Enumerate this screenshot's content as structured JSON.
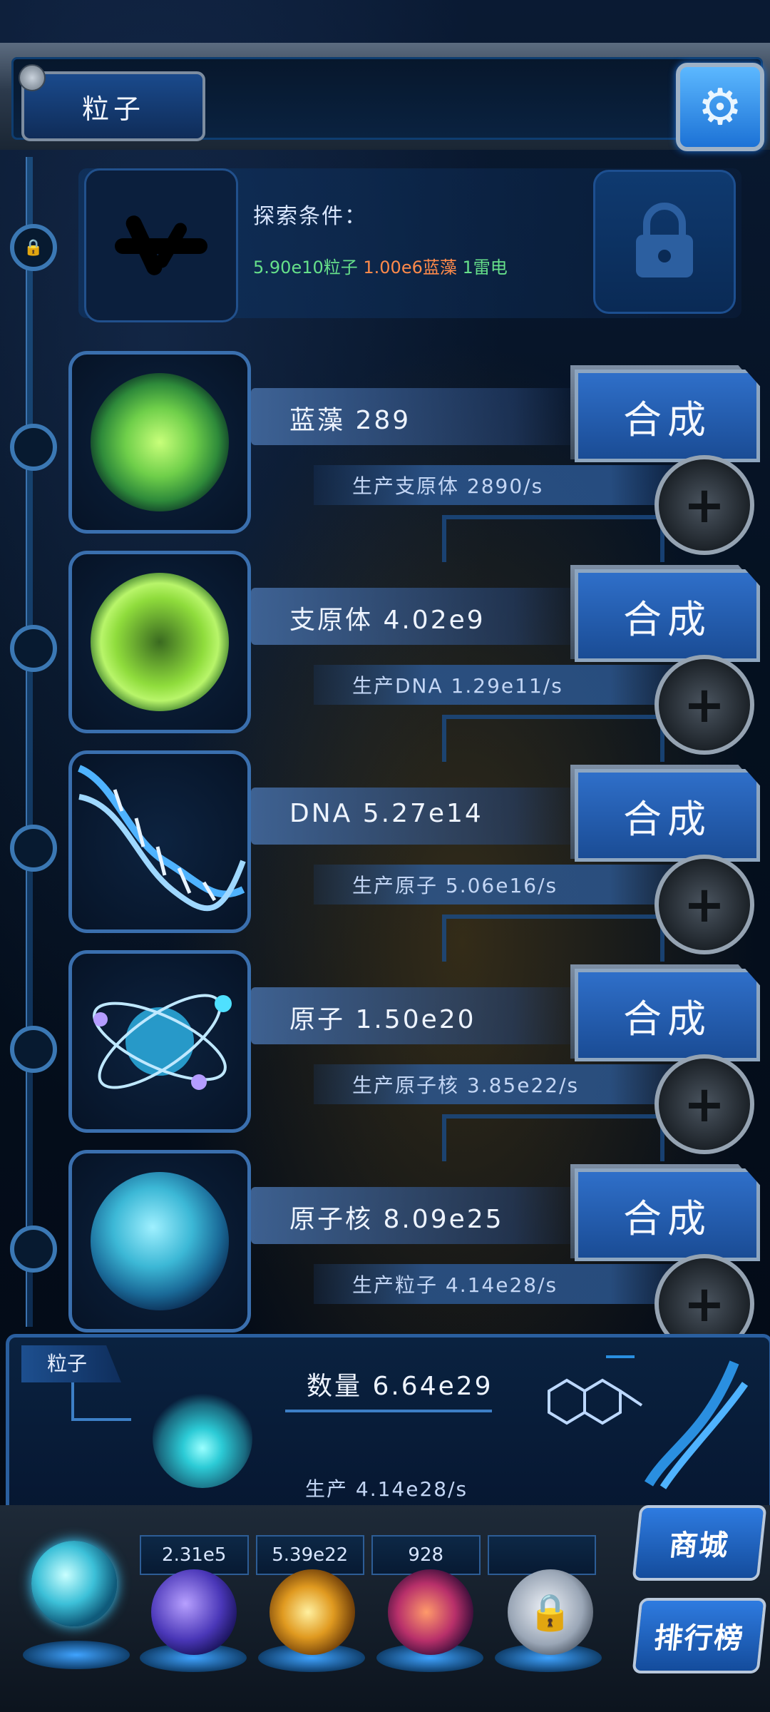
{
  "header": {
    "title": "粒子",
    "settings_icon": "gear-icon"
  },
  "explore": {
    "label": "探索条件：",
    "req_particle": "5.90e10粒子",
    "req_algae": "1.00e6蓝藻",
    "req_thunder": "1雷电",
    "lock_icon": "lock-icon"
  },
  "rows": [
    {
      "name": "蓝藻 289",
      "production": "生产支原体 2890/s",
      "synth_label": "合成"
    },
    {
      "name": "支原体 4.02e9",
      "production": "生产DNA 1.29e11/s",
      "synth_label": "合成"
    },
    {
      "name": "DNA 5.27e14",
      "production": "生产原子 5.06e16/s",
      "synth_label": "合成"
    },
    {
      "name": "原子 1.50e20",
      "production": "生产原子核 3.85e22/s",
      "synth_label": "合成"
    },
    {
      "name": "原子核 8.09e25",
      "production": "生产粒子 4.14e28/s",
      "synth_label": "合成"
    }
  ],
  "summary": {
    "tag": "粒子",
    "count": "数量 6.64e29",
    "production": "生产 4.14e28/s"
  },
  "dock": {
    "stats": [
      "2.31e5",
      "5.39e22",
      "928",
      ""
    ],
    "shop_label": "商城",
    "rank_label": "排行榜"
  },
  "colors": {
    "accent": "#2f6fc9",
    "req_green": "#66e08a",
    "req_orange": "#ff8a4a"
  }
}
